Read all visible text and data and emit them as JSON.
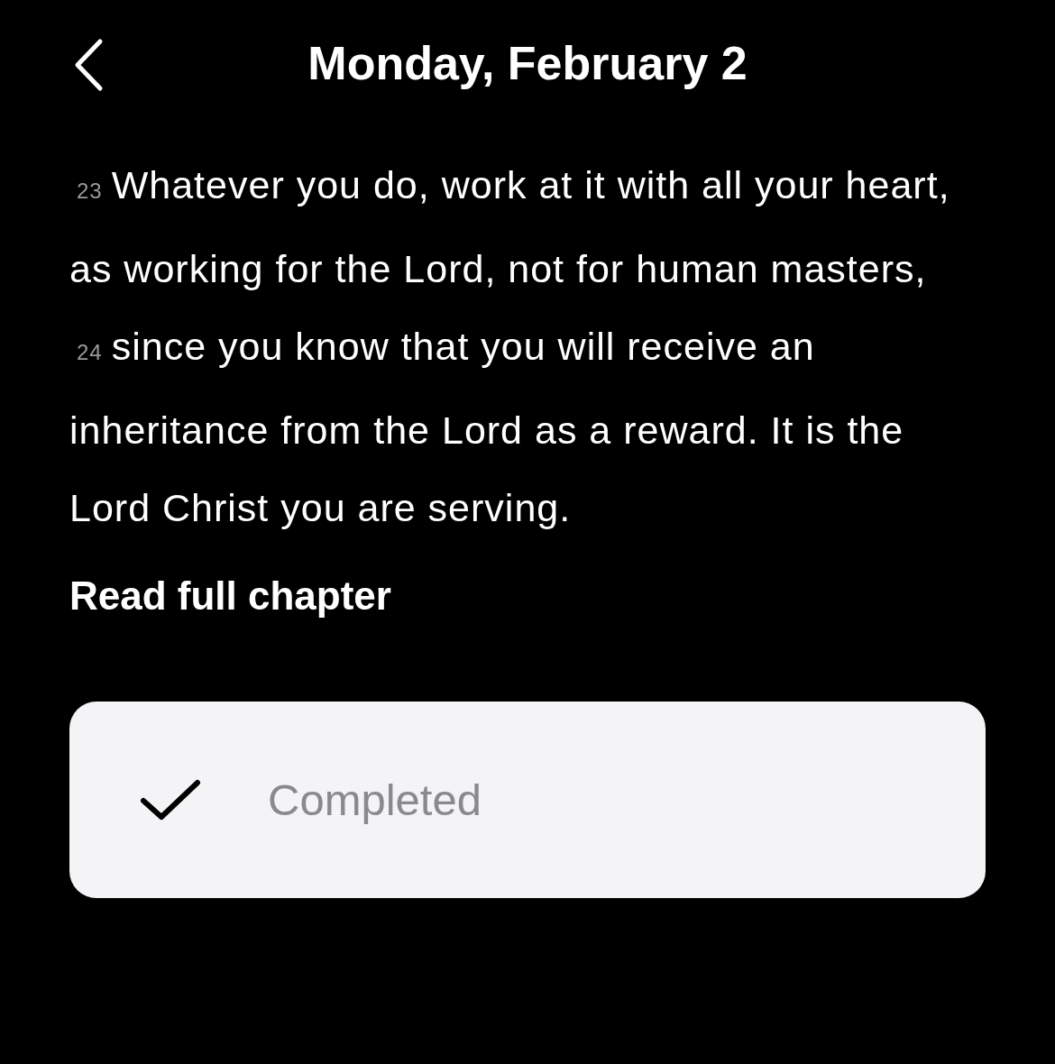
{
  "header": {
    "title": "Monday, February 2"
  },
  "verses": [
    {
      "number": "23",
      "text": "Whatever you do, work at it with all your heart, as working for the Lord, not for human masters,"
    },
    {
      "number": "24",
      "text": "since you know that you will receive an inheritance from the Lord as a reward. It is the Lord Christ you are serving."
    }
  ],
  "read_link": "Read full chapter",
  "completion": {
    "label": "Completed",
    "checked": true
  }
}
